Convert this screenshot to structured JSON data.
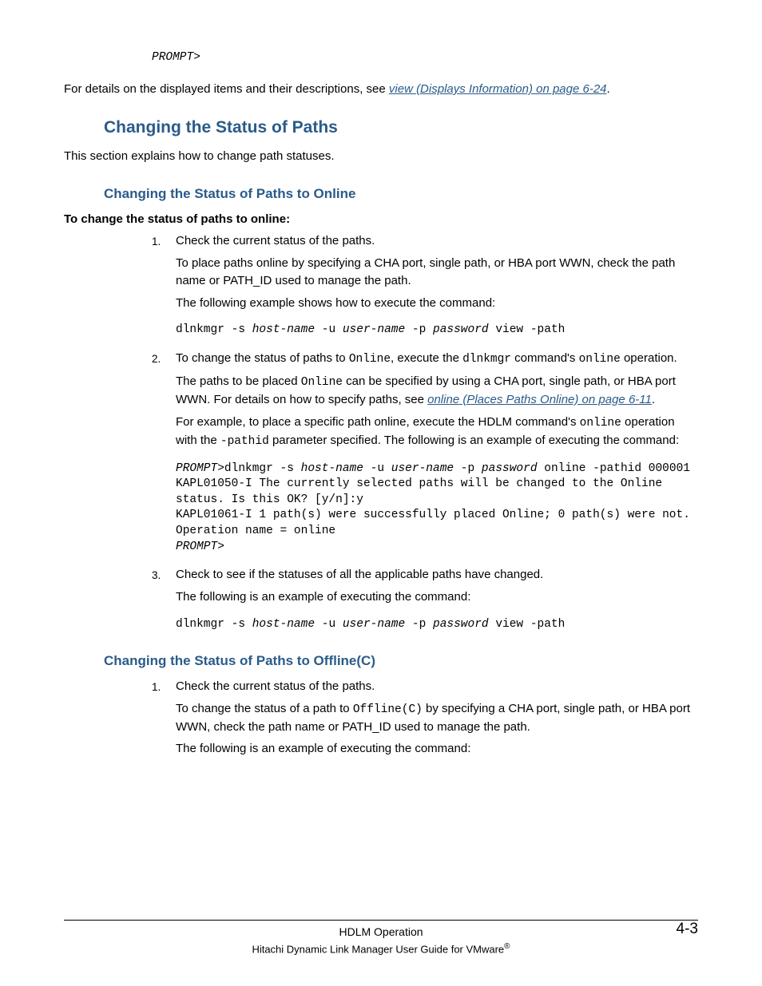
{
  "top": {
    "prompt": "PROMPT>",
    "para_a": "For details on the displayed items and their descriptions, see ",
    "link": "view (Displays Information) on page 6-24",
    "para_b": "."
  },
  "h2": "Changing the Status of Paths",
  "intro": "This section explains how to change path statuses.",
  "online": {
    "h3": "Changing the Status of Paths to Online",
    "bold": "To change the status of paths to online:",
    "s1": {
      "num": "1.",
      "l1": "Check the current status of the paths.",
      "l2": "To place paths online by specifying a CHA port, single path, or HBA port WWN, check the path name or PATH_ID used to manage the path.",
      "l3": "The following example shows how to execute the command:",
      "cmd_a": "dlnkmgr -s ",
      "cmd_b": "host-name",
      "cmd_c": " -u ",
      "cmd_d": "user-name",
      "cmd_e": " -p ",
      "cmd_f": "password",
      "cmd_g": " view -path"
    },
    "s2": {
      "num": "2.",
      "p1_a": "To change the status of paths to ",
      "p1_b": "Online",
      "p1_c": ", execute the ",
      "p1_d": "dlnkmgr",
      "p1_e": " command's ",
      "p1_f": "online",
      "p1_g": " operation.",
      "p2_a": "The paths to be placed ",
      "p2_b": "Online",
      "p2_c": " can be specified by using a CHA port, single path, or HBA port WWN. For details on how to specify paths, see ",
      "p2_link": "online (Places Paths Online) on page 6-11",
      "p2_d": ".",
      "p3_a": "For example, to place a specific path online, execute the HDLM command's ",
      "p3_b": "online",
      "p3_c": " operation with the ",
      "p3_d": "-pathid",
      "p3_e": " parameter specified. The following is an example of executing the command:",
      "cb_prompt1": "PROMPT",
      "cb_a": ">dlnkmgr -s ",
      "cb_host": "host-name",
      "cb_b": " -u ",
      "cb_user": "user-name",
      "cb_c": " -p ",
      "cb_pass": "password",
      "cb_d": " online -pathid 000001\nKAPL01050-I The currently selected paths will be changed to the Online status. Is this OK? [y/n]:y\nKAPL01061-I 1 path(s) were successfully placed Online; 0 path(s) were not. Operation name = online\n",
      "cb_prompt2": "PROMPT",
      "cb_e": ">"
    },
    "s3": {
      "num": "3.",
      "l1": "Check to see if the statuses of all the applicable paths have changed.",
      "l2": "The following is an example of executing the command:",
      "cmd_a": "dlnkmgr -s ",
      "cmd_b": "host-name",
      "cmd_c": " -u ",
      "cmd_d": "user-name",
      "cmd_e": " -p ",
      "cmd_f": "password",
      "cmd_g": " view -path"
    }
  },
  "offline": {
    "h3": "Changing the Status of Paths to Offline(C)",
    "s1": {
      "num": "1.",
      "l1": "Check the current status of the paths.",
      "l2_a": "To change the status of a path to ",
      "l2_b": "Offline(C)",
      "l2_c": " by specifying a CHA port, single path, or HBA port WWN, check the path name or PATH_ID used to manage the path.",
      "l3": "The following is an example of executing the command:"
    }
  },
  "footer": {
    "chapter": "HDLM Operation",
    "book": "Hitachi Dynamic Link Manager User Guide for VMware",
    "reg": "®",
    "page": "4-3"
  }
}
